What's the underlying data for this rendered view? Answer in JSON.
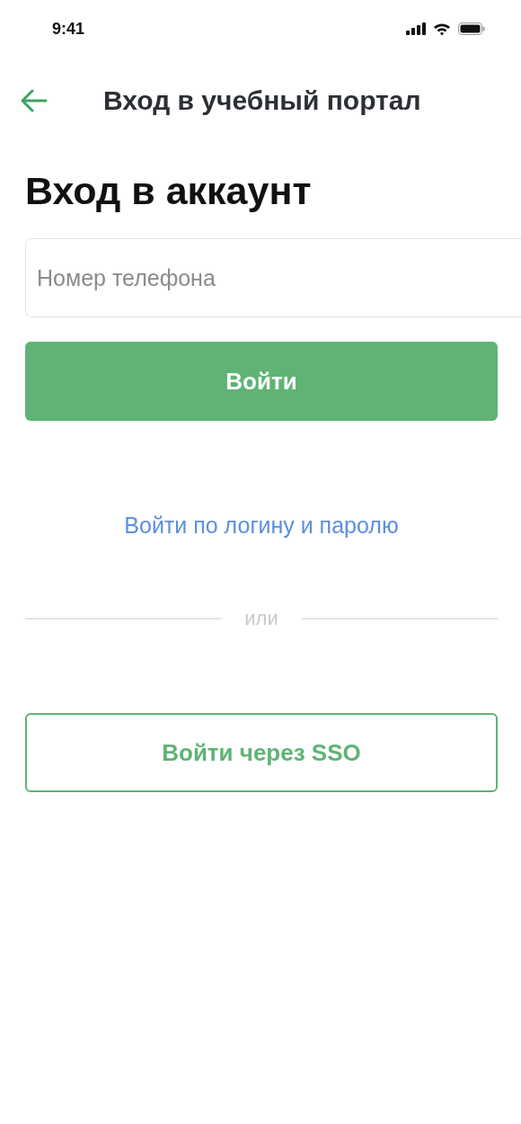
{
  "status_bar": {
    "time": "9:41"
  },
  "header": {
    "title": "Вход в учебный портал"
  },
  "heading": "Вход в аккаунт",
  "phone_field": {
    "placeholder": "Номер телефона"
  },
  "login_button": "Войти",
  "password_link": "Войти по логину и паролю",
  "divider_text": "или",
  "sso_button": "Войти через SSO"
}
